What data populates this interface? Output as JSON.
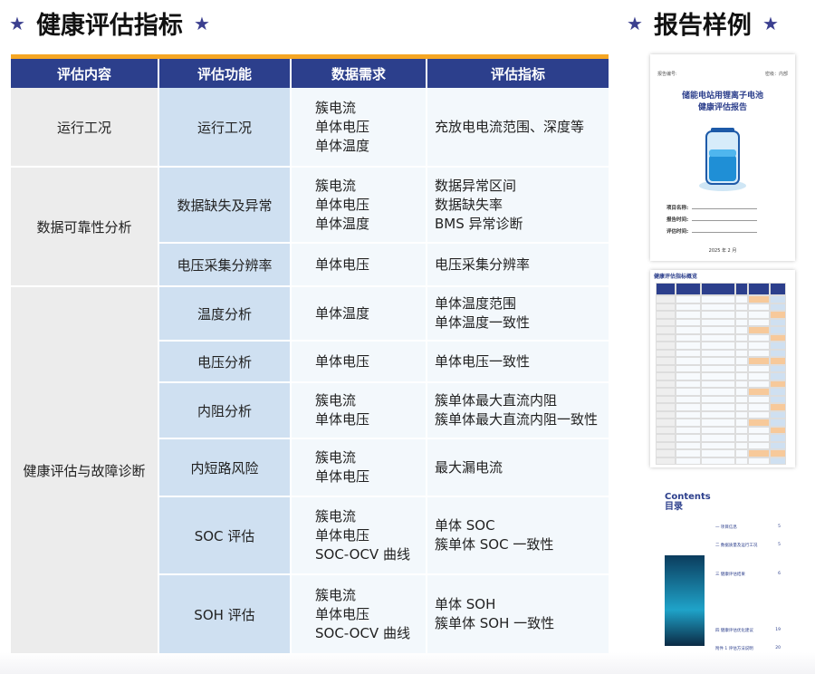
{
  "left_title": "健康评估指标",
  "right_title": "报告样例",
  "table": {
    "headers": [
      "评估内容",
      "评估功能",
      "数据需求",
      "评估指标"
    ],
    "groups": [
      {
        "category": "运行工况",
        "rows": [
          {
            "function": "运行工况",
            "data": [
              "簇电流",
              "单体电压",
              "单体温度"
            ],
            "metrics": [
              "充放电电流范围、深度等"
            ]
          }
        ]
      },
      {
        "category": "数据可靠性分析",
        "rows": [
          {
            "function": "数据缺失及异常",
            "data": [
              "簇电流",
              "单体电压",
              "单体温度"
            ],
            "metrics": [
              "数据异常区间",
              "数据缺失率",
              "BMS 异常诊断"
            ]
          },
          {
            "function": "电压采集分辨率",
            "data": [
              "单体电压"
            ],
            "metrics": [
              "电压采集分辨率"
            ]
          }
        ]
      },
      {
        "category": "健康评估与故障诊断",
        "rows": [
          {
            "function": "温度分析",
            "data": [
              "单体温度"
            ],
            "metrics": [
              "单体温度范围",
              "单体温度一致性"
            ]
          },
          {
            "function": "电压分析",
            "data": [
              "单体电压"
            ],
            "metrics": [
              "单体电压一致性"
            ]
          },
          {
            "function": "内阻分析",
            "data": [
              "簇电流",
              "单体电压"
            ],
            "metrics": [
              "簇单体最大直流内阻",
              "簇单体最大直流内阻一致性"
            ]
          },
          {
            "function": "内短路风险",
            "data": [
              "簇电流",
              "单体电压"
            ],
            "metrics": [
              "最大漏电流"
            ]
          },
          {
            "function": "SOC 评估",
            "data": [
              "簇电流",
              "单体电压",
              "SOC-OCV 曲线"
            ],
            "metrics": [
              "单体 SOC",
              "簇单体 SOC 一致性"
            ]
          },
          {
            "function": "SOH 评估",
            "data": [
              "簇电流",
              "单体电压",
              "SOC-OCV 曲线"
            ],
            "metrics": [
              "单体 SOH",
              "簇单体 SOH 一致性"
            ]
          }
        ]
      }
    ]
  },
  "report_cover": {
    "report_no_label": "报告编号:",
    "security_label": "密级：内部",
    "title_line1": "储能电站用锂离子电池",
    "title_line2": "健康评估报告",
    "fields": [
      "项目名称:",
      "报告时间:",
      "评估时间:"
    ],
    "date": "2025 年 2 月"
  },
  "report_table": {
    "title": "健康评估指标概览"
  },
  "report_contents": {
    "title_en": "Contents",
    "title_cn": "目录",
    "items": [
      {
        "label": "一 项目信息",
        "page": "5"
      },
      {
        "label": "二 数据质量及运行工况",
        "page": "5"
      },
      {
        "label": "三 健康评估结果",
        "page": "6"
      },
      {
        "label": "四 健康评估优化建议",
        "page": "19"
      },
      {
        "label": "附件 1 评估方法说明",
        "page": "20"
      }
    ]
  },
  "colors": {
    "header": "#2c3f8c",
    "accent": "#f5a623",
    "col1": "#ececec",
    "col2": "#cfe0f1",
    "cell": "#f3f8fc"
  }
}
